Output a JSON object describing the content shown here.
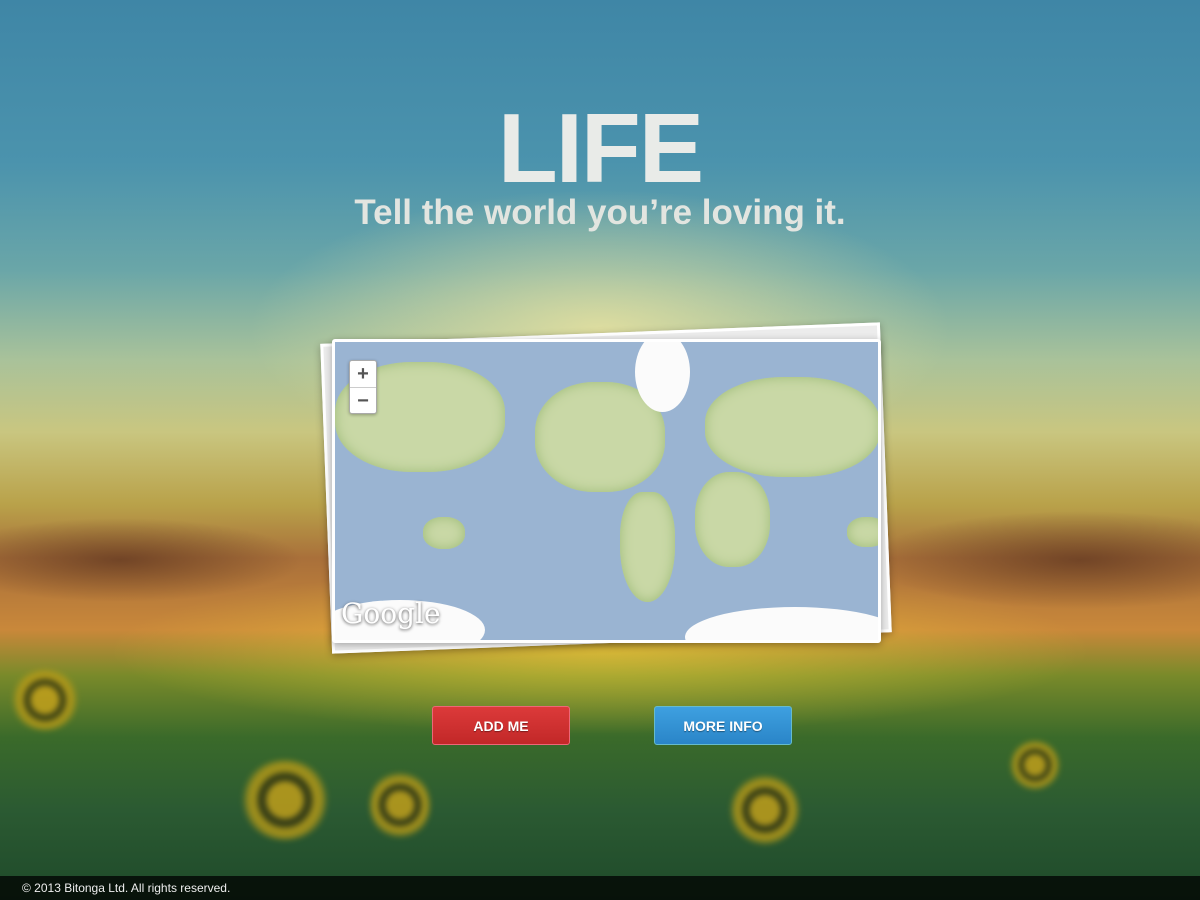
{
  "hero": {
    "title": "LIFE",
    "subtitle": "Tell the world you’re loving it."
  },
  "map": {
    "zoom_in": "+",
    "zoom_out": "−",
    "logo": "Google"
  },
  "buttons": {
    "add_me": "ADD ME",
    "more_info": "MORE INFO"
  },
  "footer": {
    "copyright": "© 2013 Bitonga Ltd. All rights reserved."
  },
  "colors": {
    "add": "#c9302c",
    "info": "#2a8ad0"
  }
}
